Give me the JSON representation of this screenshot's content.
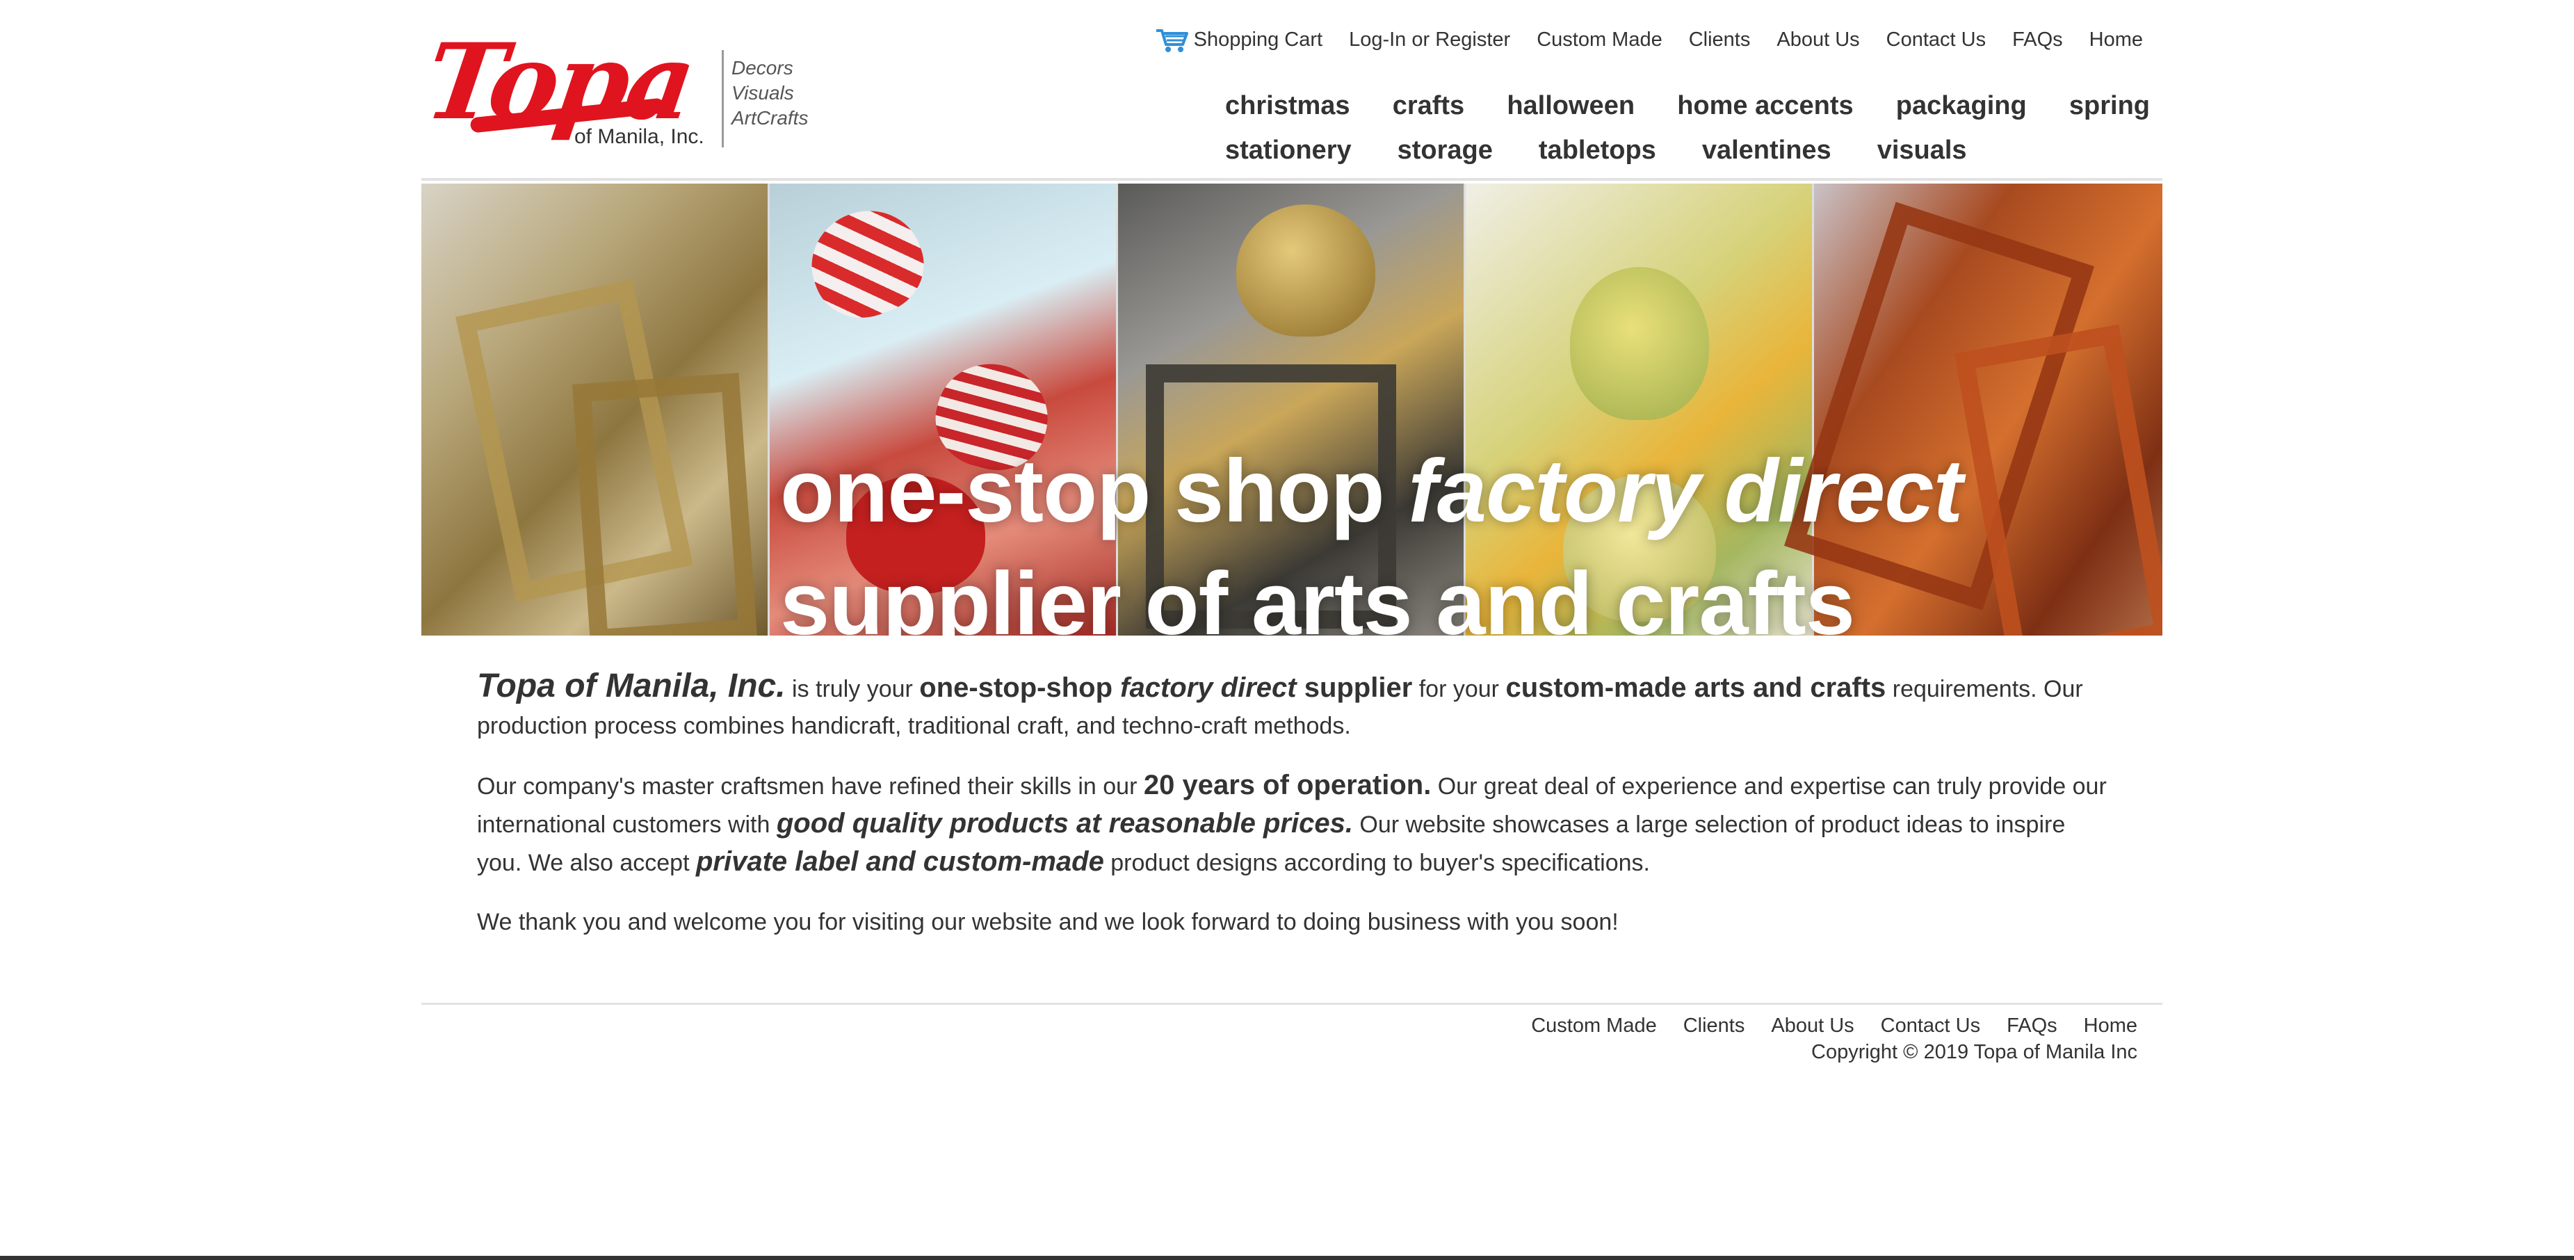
{
  "logo": {
    "word": "Topa",
    "sub": "of Manila, Inc.",
    "tags": [
      "Decors",
      "Visuals",
      "ArtCrafts"
    ]
  },
  "topnav": {
    "cart": "Shopping Cart",
    "login": "Log-In or Register",
    "custom": "Custom Made",
    "clients": "Clients",
    "about": "About Us",
    "contact": "Contact Us",
    "faqs": "FAQs",
    "home": "Home"
  },
  "categories": {
    "row1": [
      "christmas",
      "crafts",
      "halloween",
      "home accents",
      "packaging",
      "spring"
    ],
    "row2": [
      "stationery",
      "storage",
      "tabletops",
      "valentines",
      "visuals"
    ]
  },
  "banner": {
    "line1a": "one-stop shop ",
    "line1b": "factory direct",
    "line2": "supplier of arts and crafts"
  },
  "content": {
    "p1": {
      "company": "Topa of Manila, Inc.",
      "t1": " is truly your ",
      "b1": "one-stop-shop ",
      "i1": "factory direct",
      "b2": " supplier",
      "t2": " for your ",
      "b3": "custom-made arts and crafts",
      "t3": " requirements. Our production process combines handicraft, traditional craft, and techno-craft methods."
    },
    "p2": {
      "t1": "Our company's master craftsmen have refined their skills in our ",
      "b1": "20 years of operation.",
      "t2": " Our great deal of experience and expertise can truly provide our international customers with ",
      "i1": "good quality products at reasonable prices.",
      "t3": " Our website showcases a large selection of product ideas to inspire you. We also accept ",
      "i2": "private label and custom-made",
      "t4": " product designs according to buyer's specifications."
    },
    "p3": "We thank you and welcome you for visiting our website and we look forward to doing business with you soon!"
  },
  "footer": {
    "custom": "Custom Made",
    "clients": "Clients",
    "about": "About Us",
    "contact": "Contact Us",
    "faqs": "FAQs",
    "home": "Home",
    "copyright": "Copyright © 2019 Topa of Manila Inc"
  },
  "colors": {
    "brand_red": "#e0141e",
    "text": "#333333",
    "cart_icon": "#2f8fd8"
  },
  "icons": {
    "cart": "shopping-cart-icon"
  }
}
